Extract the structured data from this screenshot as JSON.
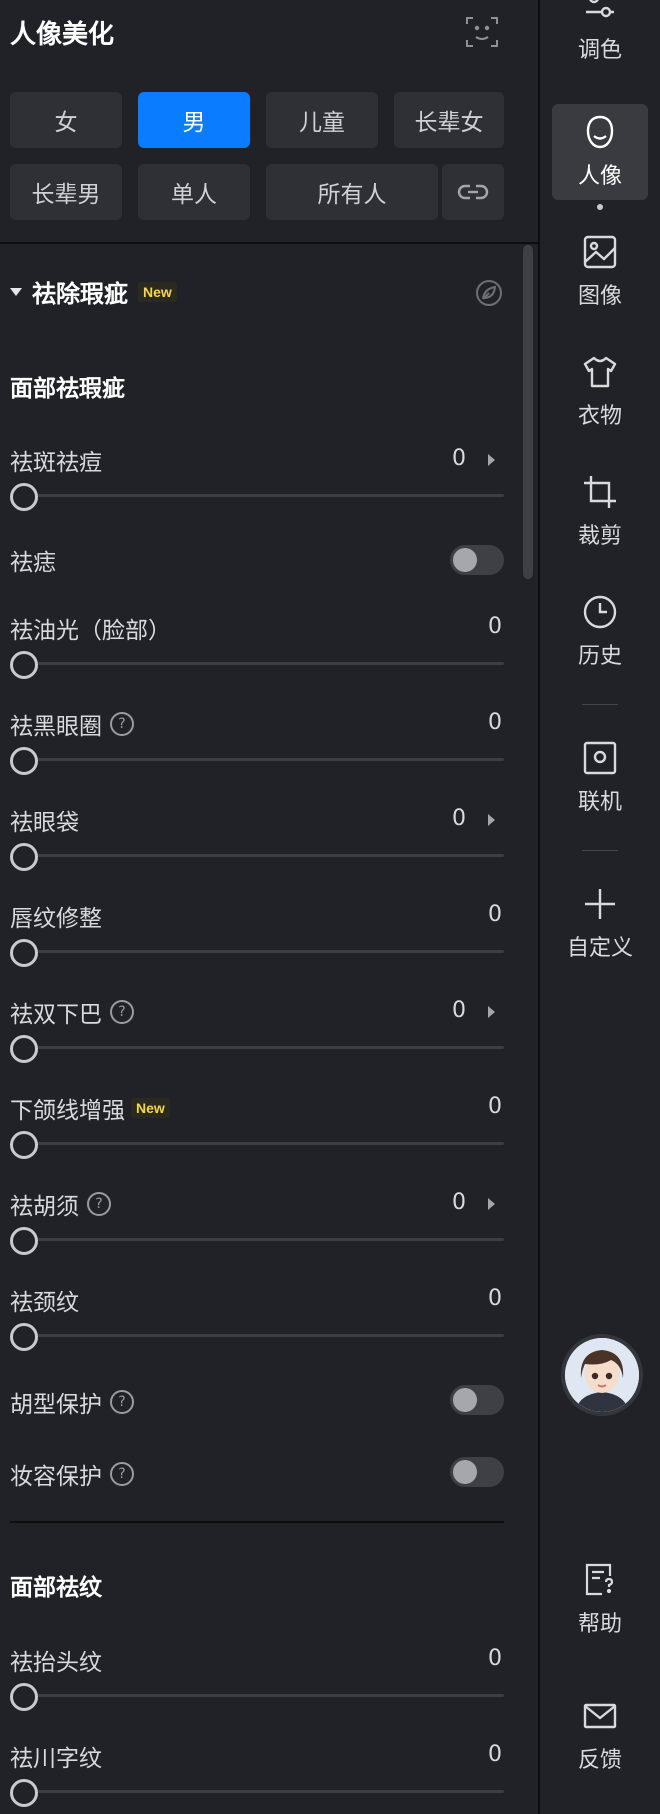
{
  "panel": {
    "title": "人像美化",
    "face_scan_icon": "face-scan-icon"
  },
  "filters": {
    "row1": [
      "女",
      "男",
      "儿童",
      "长辈女"
    ],
    "row2": [
      "长辈男",
      "单人",
      "所有人"
    ],
    "active": "男",
    "link_icon": "link-icon"
  },
  "section": {
    "title": "祛除瑕疵",
    "badge": "New",
    "leaf_icon": "leaf-icon"
  },
  "groups": [
    {
      "title": "面部祛瑕疵",
      "rows": [
        {
          "label": "祛斑祛痘",
          "type": "slider",
          "value": "0",
          "has_arrow": true,
          "has_help": false
        },
        {
          "label": "祛痣",
          "type": "toggle",
          "on": false
        },
        {
          "label": "祛油光（脸部）",
          "type": "slider",
          "value": "0",
          "has_arrow": false,
          "has_help": false
        },
        {
          "label": "祛黑眼圈",
          "type": "slider",
          "value": "0",
          "has_arrow": false,
          "has_help": true
        },
        {
          "label": "祛眼袋",
          "type": "slider",
          "value": "0",
          "has_arrow": true,
          "has_help": false
        },
        {
          "label": "唇纹修整",
          "type": "slider",
          "value": "0",
          "has_arrow": false,
          "has_help": false
        },
        {
          "label": "祛双下巴",
          "type": "slider",
          "value": "0",
          "has_arrow": true,
          "has_help": true
        },
        {
          "label": "下颌线增强",
          "type": "slider",
          "value": "0",
          "has_arrow": false,
          "has_help": false,
          "badge": "New"
        },
        {
          "label": "祛胡须",
          "type": "slider",
          "value": "0",
          "has_arrow": true,
          "has_help": true
        },
        {
          "label": "祛颈纹",
          "type": "slider",
          "value": "0",
          "has_arrow": false,
          "has_help": false
        },
        {
          "label": "胡型保护",
          "type": "toggle",
          "on": false,
          "has_help": true
        },
        {
          "label": "妆容保护",
          "type": "toggle",
          "on": false,
          "has_help": true
        }
      ]
    },
    {
      "title": "面部祛纹",
      "rows": [
        {
          "label": "祛抬头纹",
          "type": "slider",
          "value": "0",
          "has_arrow": false,
          "has_help": false
        },
        {
          "label": "祛川字纹",
          "type": "slider",
          "value": "0",
          "has_arrow": false,
          "has_help": false
        }
      ]
    }
  ],
  "rail": {
    "items": [
      {
        "label": "调色",
        "icon": "color-adjust-icon",
        "active": false
      },
      {
        "label": "人像",
        "icon": "portrait-icon",
        "active": true
      },
      {
        "label": "图像",
        "icon": "image-icon",
        "active": false
      },
      {
        "label": "衣物",
        "icon": "clothing-icon",
        "active": false
      },
      {
        "label": "裁剪",
        "icon": "crop-icon",
        "active": false
      },
      {
        "label": "历史",
        "icon": "history-icon",
        "active": false
      },
      {
        "label": "联机",
        "icon": "tether-icon",
        "active": false
      },
      {
        "label": "自定义",
        "icon": "plus-icon",
        "active": false
      },
      {
        "label": "帮助",
        "icon": "help-doc-icon",
        "active": false
      },
      {
        "label": "反馈",
        "icon": "mail-icon",
        "active": false
      }
    ],
    "assistant_icon": "assistant-avatar-icon"
  },
  "colors": {
    "accent": "#0a7cff",
    "background": "#212227",
    "badge_text": "#f6d54a"
  }
}
